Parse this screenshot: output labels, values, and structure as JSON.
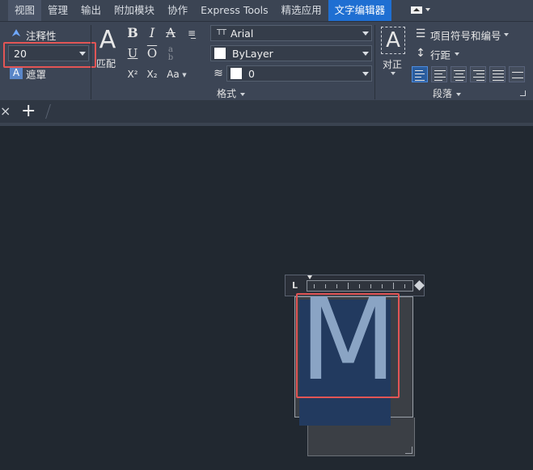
{
  "menu": {
    "tabs": [
      "视图",
      "管理",
      "输出",
      "附加模块",
      "协作",
      "Express Tools",
      "精选应用",
      "文字编辑器"
    ],
    "active_tab": "文字编辑器"
  },
  "style_panel": {
    "annotative_label": "注释性",
    "text_height": "20",
    "mask_label": "遮罩"
  },
  "format_panel": {
    "match_label": "匹配",
    "bold": "B",
    "italic": "I",
    "strike": "A",
    "underline": "U",
    "overline": "O",
    "superscript": "X²",
    "subscript": "X₂",
    "case": "Aa",
    "font": "Arial",
    "font_prefix": "TT",
    "color": "ByLayer",
    "oblique": "0",
    "title": "格式"
  },
  "paragraph_panel": {
    "justify_label": "对正",
    "bullets_label": "项目符号和编号",
    "line_spacing_label": "行距",
    "title": "段落"
  },
  "doc_tabs": {
    "close": "×",
    "new": "+"
  },
  "editor": {
    "text": "M",
    "ruler_start": "L"
  },
  "colors": {
    "menubar": "#3b4453",
    "active_tab": "#1f6fd2",
    "ribbon": "#3c4555",
    "canvas": "#212830",
    "highlight": "#e25555"
  }
}
